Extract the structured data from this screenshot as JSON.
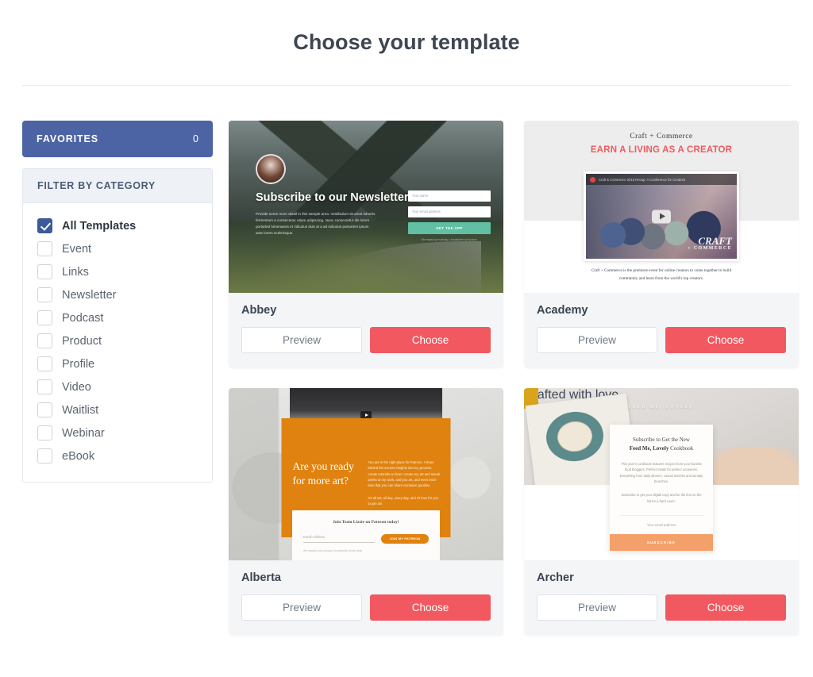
{
  "header": {
    "title": "Choose your template"
  },
  "sidebar": {
    "favorites": {
      "label": "FAVORITES",
      "count": "0"
    },
    "filter": {
      "header": "FILTER BY CATEGORY",
      "items": [
        {
          "label": "All Templates",
          "checked": true
        },
        {
          "label": "Event",
          "checked": false
        },
        {
          "label": "Links",
          "checked": false
        },
        {
          "label": "Newsletter",
          "checked": false
        },
        {
          "label": "Podcast",
          "checked": false
        },
        {
          "label": "Product",
          "checked": false
        },
        {
          "label": "Profile",
          "checked": false
        },
        {
          "label": "Video",
          "checked": false
        },
        {
          "label": "Waitlist",
          "checked": false
        },
        {
          "label": "Webinar",
          "checked": false
        },
        {
          "label": "eBook",
          "checked": false
        }
      ]
    }
  },
  "buttons": {
    "preview": "Preview",
    "choose": "Choose"
  },
  "templates": [
    {
      "name": "Abbey",
      "preview": {
        "heading": "Subscribe to our Newsletter",
        "body": "Provide some more detail in this sample area. Vestibulum sit amet lobortis fermentum a consectetur etiam adipiscing. Nunc consectetur dis lorem portarled himenaeos et ridiculus duis at a ad ridiculus parturient ipsum ante lorem scelerisque.",
        "input_name_placeholder": "Your name",
        "input_email_placeholder": "Your email address",
        "cta": "GET THE APP",
        "fine_print": "We respect your privacy. Unsubscribe at any time."
      }
    },
    {
      "name": "Academy",
      "preview": {
        "brand": "Craft + Commerce",
        "heading": "EARN A LIVING AS A CREATOR",
        "video_title": "Craft & Commerce 2019 Recap: A Conference for Creators",
        "watermark_line1": "CRAFT",
        "watermark_line2": "+ COMMERCE",
        "description": "Craft + Commerce is the premiere event for online creators to come together to build community and learn from the world's top creators."
      }
    },
    {
      "name": "Alberta",
      "preview": {
        "heading": "Are you ready for more art?",
        "body": "You are in the right place for Patreon. I share behind the scenes insights into my process, create tutorials on how I create my art and sneak peeks at my work, and you art, and even more time that you can share exclusive goodies.",
        "body2": "It's all art, all day, every day, and I'd love for you to join us!",
        "form_heading": "Join Team Lizzie on Patreon today!",
        "input_placeholder": "Email Address",
        "cta": "JOIN MY PATREON",
        "fine_print": "We respect your privacy. Unsubscribe at any time."
      }
    },
    {
      "name": "Archer",
      "preview": {
        "kicker": "FEED ME, LOVELY",
        "heading_line1": "Subscribe to Get the New",
        "heading_line2_bold": "Feed Me, Lovely",
        "heading_line2_rest": " Cookbook",
        "body": "This year's cookbook features recipes from your favorite food bloggers. Perfect meals for perfect occasions. Everything from daily dinners, casual lunches and sunday brunches.",
        "body2": "Subscribe to get your digital copy and be the first on the list for a hard cover.",
        "input_placeholder": "Your email address",
        "cta": "SUBSCRIBE",
        "credit": "Crafted with love"
      }
    }
  ],
  "colors": {
    "favorites_bg": "#4c63a4",
    "choose_bg": "#f2585f",
    "checkbox_checked": "#3c5a9a",
    "filter_header_bg": "#eef1f6",
    "card_bg": "#f3f5f7"
  }
}
